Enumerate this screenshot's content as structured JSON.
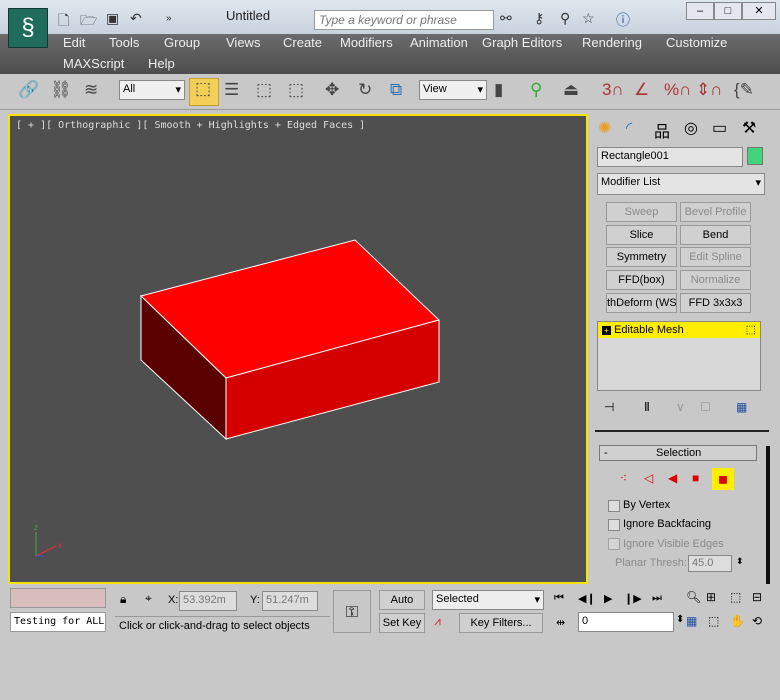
{
  "window": {
    "title": "Untitled",
    "search_placeholder": "Type a keyword or phrase"
  },
  "menu": [
    "Edit",
    "Tools",
    "Group",
    "Views",
    "Create",
    "Modifiers",
    "Animation",
    "Graph Editors",
    "Rendering",
    "Customize",
    "MAXScript",
    "Help"
  ],
  "toolbar": {
    "selection_filter": "All",
    "reference_coord": "View"
  },
  "viewport": {
    "label": "[ + ][ Orthographic ][ Smooth + Highlights + Edged Faces ]",
    "object_color": "#ff0000"
  },
  "command_panel": {
    "object_name": "Rectangle001",
    "object_color": "#44d27a",
    "modifier_list": "Modifier List",
    "buttons": [
      {
        "label": "Sweep",
        "enabled": false
      },
      {
        "label": "Bevel Profile",
        "enabled": false
      },
      {
        "label": "Slice",
        "enabled": true
      },
      {
        "label": "Bend",
        "enabled": true
      },
      {
        "label": "Symmetry",
        "enabled": true
      },
      {
        "label": "Edit Spline",
        "enabled": false
      },
      {
        "label": "FFD(box)",
        "enabled": true
      },
      {
        "label": "Normalize Spl.",
        "enabled": false
      },
      {
        "label": "thDeform (WSM",
        "enabled": true
      },
      {
        "label": "FFD 3x3x3",
        "enabled": true
      }
    ],
    "stack_item": "Editable Mesh",
    "rollout": {
      "title": "Selection",
      "collapse": "-",
      "by_vertex": "By Vertex",
      "ignore_backfacing": "Ignore Backfacing",
      "ignore_visible_edges": "Ignore Visible Edges",
      "planar_thresh_label": "Planar Thresh:",
      "planar_thresh": "45.0"
    }
  },
  "status": {
    "script_text": "Testing for ALL",
    "x_label": "X:",
    "x": "53.392m",
    "y_label": "Y:",
    "y": "51.247m",
    "prompt": "Click or click-and-drag to select objects",
    "auto_key": "Auto Key",
    "set_key": "Set Key",
    "key_mode": "Selected",
    "key_filters": "Key Filters...",
    "frame": "0"
  }
}
